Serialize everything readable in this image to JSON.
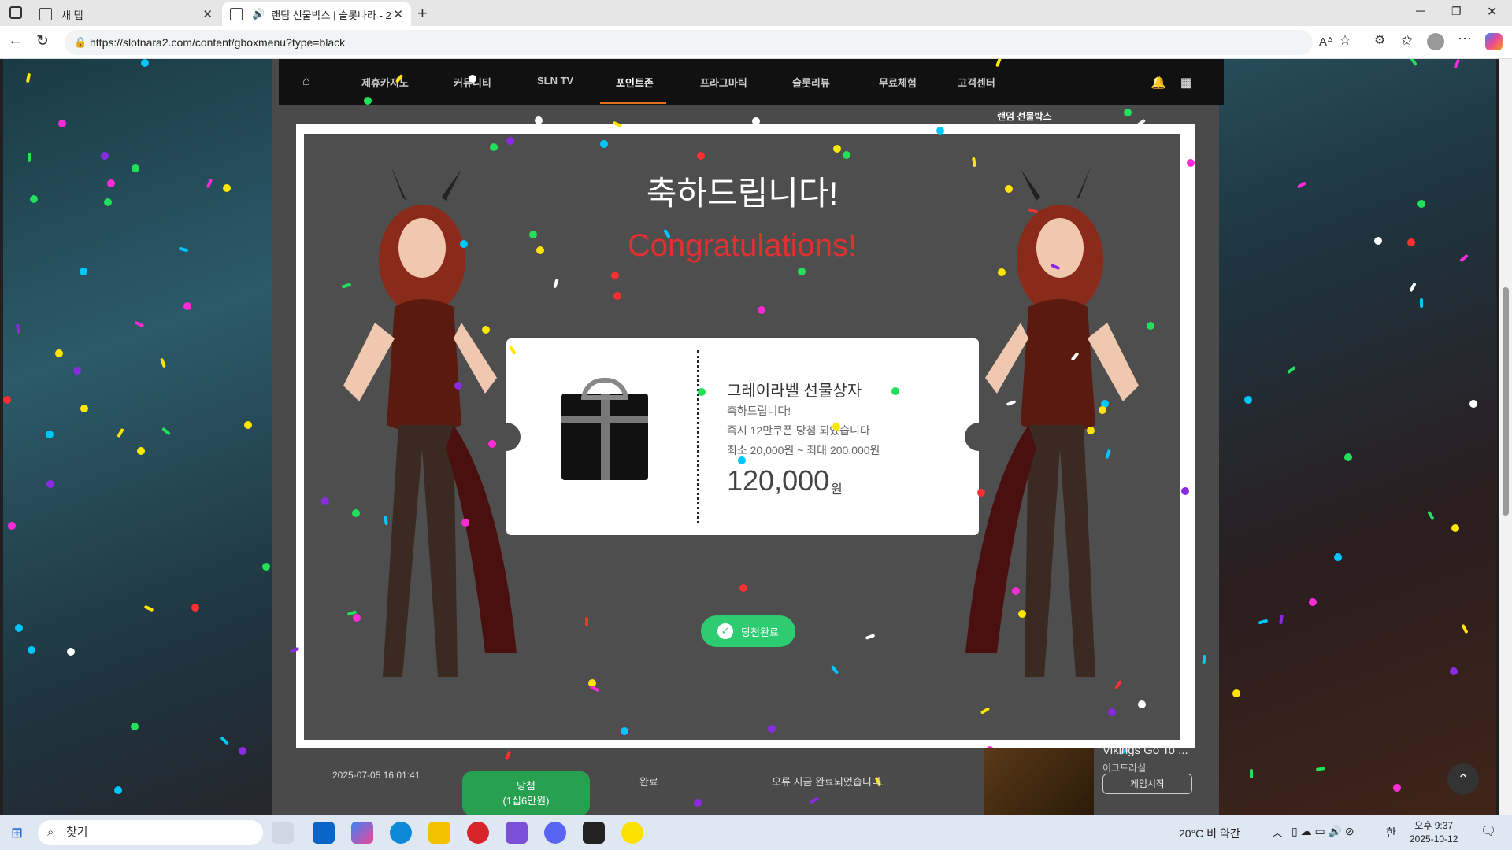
{
  "browser": {
    "tabs": [
      {
        "title": "새 탭"
      },
      {
        "title": "랜덤 선물박스 | 슬롯나라 - 2"
      }
    ],
    "url": "https://slotnara2.com/content/gboxmenu?type=black"
  },
  "site_nav": {
    "items": [
      "제휴카지노",
      "커뮤니티",
      "SLN TV",
      "포인트존",
      "프라그마틱",
      "슬롯리뷰",
      "무료체험",
      "고객센터"
    ],
    "side_title": "랜덤 선물박스"
  },
  "modal": {
    "title_ko": "축하드립니다!",
    "title_en": "Congratulations!",
    "prize_name": "그레이라벨 선물상자",
    "congrats": "축하드립니다!",
    "detail": "즉시 12만쿠폰 당첨 되었습니다",
    "range": "최소 20,000원 ~ 최대 200,000원",
    "amount": "120,000",
    "amount_unit": "원",
    "button_label": "당첨완료"
  },
  "below": {
    "date": "2025-07-05 16:01:41",
    "win_label": "당첨",
    "win_sub": "(1십6만원)",
    "status": "완료",
    "message": "오류 지금 완료되었습니다.",
    "game_title": "Vikings Go To ...",
    "game_sub": "이그드라실",
    "game_button": "게임시작"
  },
  "taskbar": {
    "search_placeholder": "찾기",
    "weather": "20°C 비 약간",
    "time": "오후 9:37",
    "date": "2025-10-12",
    "ime": "한"
  },
  "colors": {
    "accent_green": "#2ecc71",
    "title_red": "#e03030",
    "modal_bg": "#4e4e4e"
  }
}
